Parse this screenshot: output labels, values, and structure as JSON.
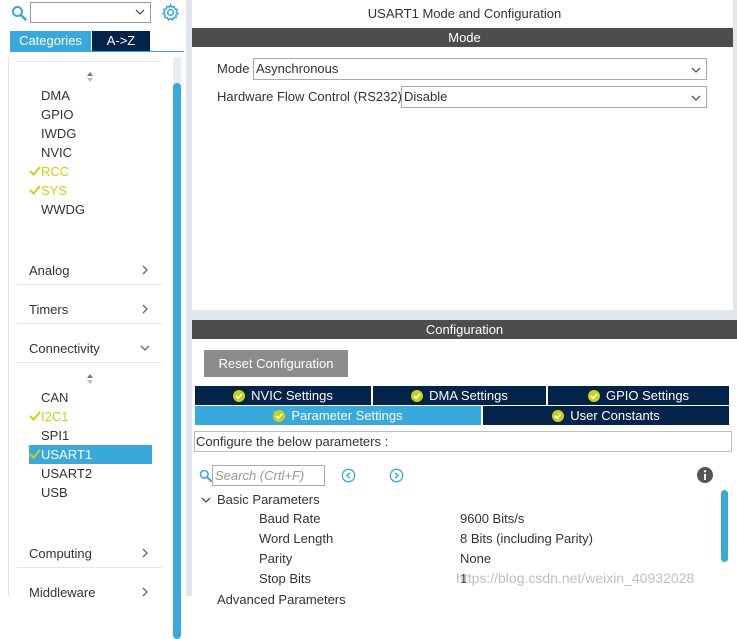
{
  "left": {
    "search_value": "",
    "tabs": {
      "categories": "Categories",
      "az": "A->Z"
    },
    "system_core_items": [
      {
        "label": "DMA",
        "ok": false
      },
      {
        "label": "GPIO",
        "ok": false
      },
      {
        "label": "IWDG",
        "ok": false
      },
      {
        "label": "NVIC",
        "ok": false
      },
      {
        "label": "RCC",
        "ok": true
      },
      {
        "label": "SYS",
        "ok": true
      },
      {
        "label": "WWDG",
        "ok": false
      }
    ],
    "groups": {
      "analog": "Analog",
      "timers": "Timers",
      "connectivity": "Connectivity",
      "computing": "Computing",
      "middleware": "Middleware"
    },
    "connectivity_items": [
      {
        "label": "CAN",
        "ok": false
      },
      {
        "label": "I2C1",
        "ok": true
      },
      {
        "label": "SPI1",
        "ok": false
      },
      {
        "label": "USART1",
        "ok": true,
        "selected": true
      },
      {
        "label": "USART2",
        "ok": false
      },
      {
        "label": "USB",
        "ok": false
      }
    ]
  },
  "mode": {
    "title": "USART1 Mode and Configuration",
    "bar": "Mode",
    "mode_label": "Mode",
    "mode_value": "Asynchronous",
    "hfc_label": "Hardware Flow Control (RS232)",
    "hfc_value": "Disable"
  },
  "config": {
    "bar": "Configuration",
    "reset_button": "Reset Configuration",
    "tabs_row1": [
      "NVIC Settings",
      "DMA Settings",
      "GPIO Settings"
    ],
    "tabs_row2": [
      "Parameter Settings",
      "User Constants"
    ],
    "hint": "Configure the below parameters :",
    "search_placeholder": "Search (Crtl+F)",
    "section": "Basic Parameters",
    "params": [
      {
        "name": "Baud Rate",
        "value": "9600 Bits/s"
      },
      {
        "name": "Word Length",
        "value": "8 Bits (including Parity)"
      },
      {
        "name": "Parity",
        "value": "None"
      },
      {
        "name": "Stop Bits",
        "value": "1"
      }
    ],
    "next_section_partial": "Advanced Parameters"
  },
  "watermark": "https://blog.csdn.net/weixin_40932028",
  "colors": {
    "accent": "#39a9dc",
    "navy": "#03234b",
    "ok": "#c9d21b",
    "bar": "#4d4d4d"
  }
}
